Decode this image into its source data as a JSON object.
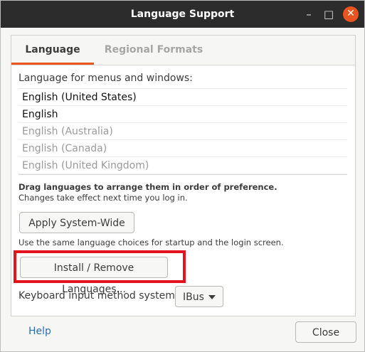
{
  "window": {
    "title": "Language Support",
    "controls": {
      "minimize": "–",
      "maximize": "□",
      "close": "✕"
    }
  },
  "tabs": [
    {
      "label": "Language",
      "active": true
    },
    {
      "label": "Regional Formats",
      "active": false
    }
  ],
  "language": {
    "section_label": "Language for menus and windows:",
    "items": [
      {
        "label": "English (United States)",
        "enabled": true
      },
      {
        "label": "English",
        "enabled": true
      },
      {
        "label": "English (Australia)",
        "enabled": false
      },
      {
        "label": "English (Canada)",
        "enabled": false
      },
      {
        "label": "English (United Kingdom)",
        "enabled": false
      }
    ],
    "hint_bold": "Drag languages to arrange them in order of preference.",
    "hint": "Changes take effect next time you log in.",
    "apply_button": "Apply System-Wide",
    "apply_note": "Use the same language choices for startup and the login screen.",
    "install_button": "Install / Remove Languages...",
    "keyboard_label": "Keyboard input method system:",
    "keyboard_value": "IBus"
  },
  "footer": {
    "help": "Help",
    "close": "Close"
  },
  "colors": {
    "titlebar": "#2c2c2c",
    "accent": "#e95420",
    "highlight": "#e3141e",
    "link": "#2c6eb4"
  }
}
